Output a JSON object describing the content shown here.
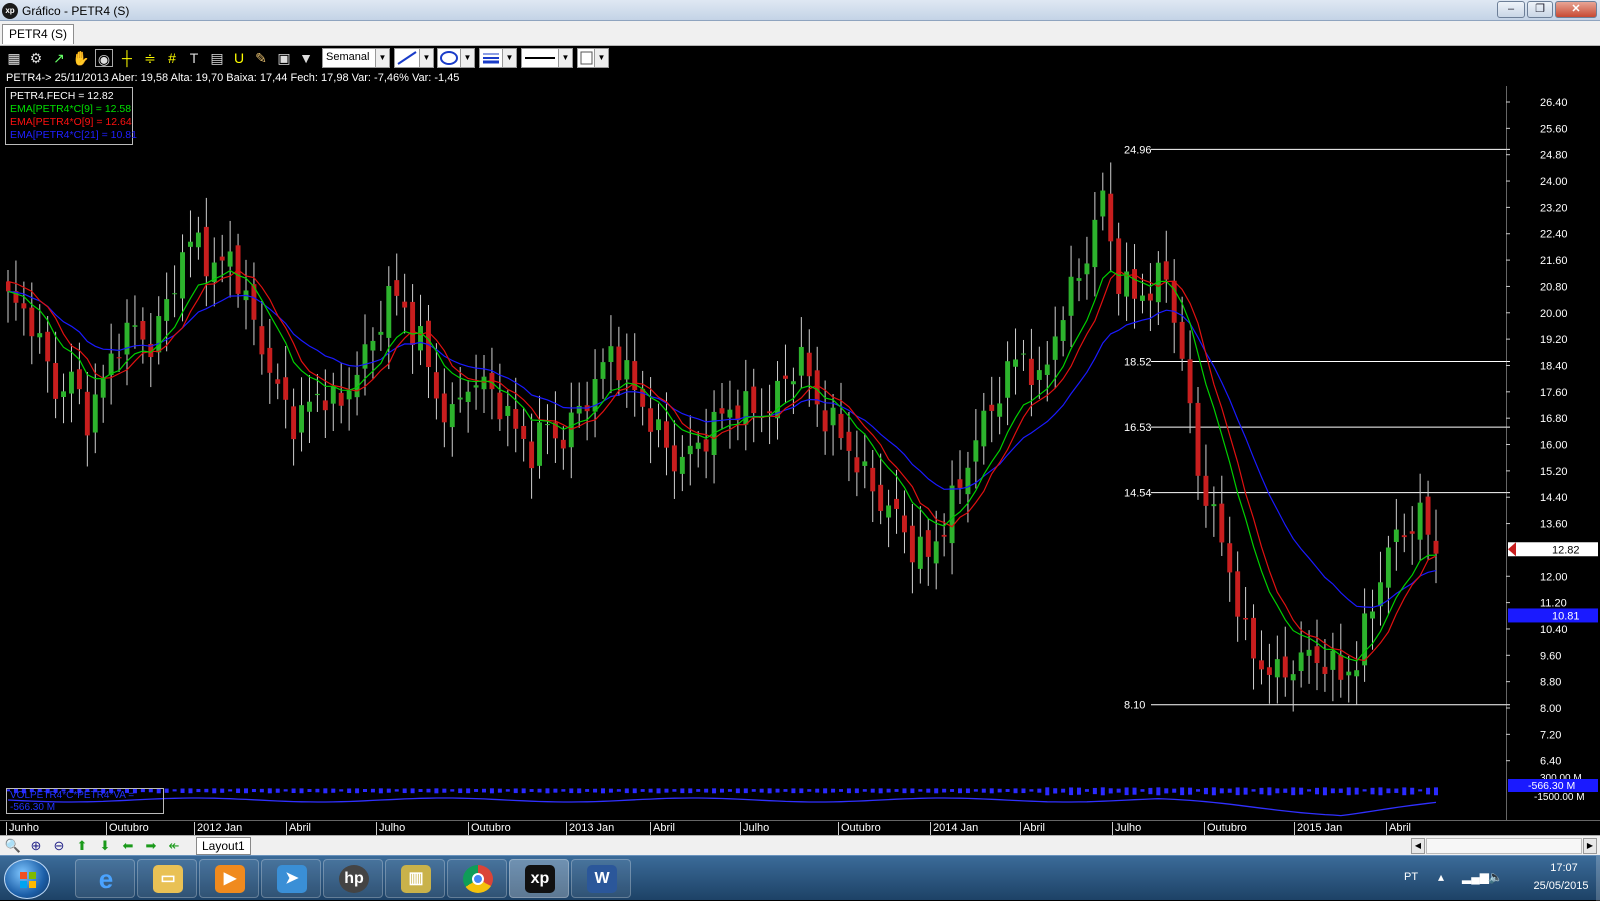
{
  "window": {
    "title": "Gráfico - PETR4 (S)",
    "app_icon": "xp",
    "min": "–",
    "max": "❐",
    "close": "✕"
  },
  "tab": {
    "label": "PETR4 (S)"
  },
  "toolbar": {
    "period": "Semanal"
  },
  "info_line": "PETR4-> 25/11/2013 Aber: 19,58 Alta: 19,70 Baixa: 17,44 Fech: 17,98 Var: -7,46% Var: -1,45",
  "legend": [
    {
      "text": "PETR4.FECH = 12.82",
      "color": "#ffffff"
    },
    {
      "text": "EMA[PETR4*C[9] = 12.58",
      "color": "#00e000"
    },
    {
      "text": "EMA[PETR4*O[9] = 12.64",
      "color": "#ff1010"
    },
    {
      "text": "EMA[PETR4*C[21] = 10.81",
      "color": "#2020ff"
    }
  ],
  "colors": {
    "up": "#2db32d",
    "down": "#c81e1e",
    "ema9c": "#00d000",
    "ema9o": "#e01010",
    "ema21": "#1a1aff",
    "grid_line": "#ffffff"
  },
  "chart_data": {
    "type": "candlestick",
    "price_axis_ticks": [
      "26.40",
      "25.60",
      "24.80",
      "24.00",
      "23.20",
      "22.40",
      "21.60",
      "20.80",
      "20.00",
      "19.20",
      "18.40",
      "17.60",
      "16.80",
      "16.00",
      "15.20",
      "14.40",
      "13.60",
      "12.00",
      "11.20",
      "10.40",
      "9.60",
      "8.80",
      "8.00",
      "7.20",
      "6.40"
    ],
    "ylim": [
      6.0,
      27.0
    ],
    "levels": [
      24.96,
      18.52,
      16.53,
      14.54,
      8.1
    ],
    "level_labels": [
      "24.96",
      "18.52",
      "16.53",
      "14.54",
      "8.10"
    ],
    "last_close": {
      "value": 12.82,
      "label": "12.82"
    },
    "ema21_last": {
      "value": 10.81,
      "label": "10.81"
    },
    "time_labels": [
      "Junho",
      "Outubro",
      "2012 Jan",
      "Abril",
      "Julho",
      "Outubro",
      "2013 Jan",
      "Abril",
      "Julho",
      "Outubro",
      "2014 Jan",
      "Abril",
      "Julho",
      "Outubro",
      "2015 Jan",
      "Abril"
    ],
    "close_path": [
      [
        0,
        20.4
      ],
      [
        3,
        19.8
      ],
      [
        6,
        17.6
      ],
      [
        8,
        18.0
      ],
      [
        10,
        16.8
      ],
      [
        12,
        17.9
      ],
      [
        14,
        19.2
      ],
      [
        16,
        19.5
      ],
      [
        18,
        19.0
      ],
      [
        20,
        20.2
      ],
      [
        22,
        21.8
      ],
      [
        24,
        22.2
      ],
      [
        26,
        21.2
      ],
      [
        28,
        21.8
      ],
      [
        30,
        20.3
      ],
      [
        32,
        19.0
      ],
      [
        34,
        17.6
      ],
      [
        36,
        16.7
      ],
      [
        38,
        17.2
      ],
      [
        40,
        17.6
      ],
      [
        42,
        17.1
      ],
      [
        44,
        18.4
      ],
      [
        46,
        19.0
      ],
      [
        48,
        20.7
      ],
      [
        50,
        20.0
      ],
      [
        52,
        19.2
      ],
      [
        54,
        17.4
      ],
      [
        56,
        16.8
      ],
      [
        58,
        17.9
      ],
      [
        60,
        17.8
      ],
      [
        62,
        17.3
      ],
      [
        64,
        16.4
      ],
      [
        66,
        15.8
      ],
      [
        68,
        16.6
      ],
      [
        70,
        16.1
      ],
      [
        72,
        17.1
      ],
      [
        74,
        17.8
      ],
      [
        76,
        18.9
      ],
      [
        78,
        18.1
      ],
      [
        80,
        17.2
      ],
      [
        82,
        16.3
      ],
      [
        84,
        15.5
      ],
      [
        86,
        15.7
      ],
      [
        88,
        16.3
      ],
      [
        90,
        16.9
      ],
      [
        92,
        17.2
      ],
      [
        94,
        17.0
      ],
      [
        96,
        17.1
      ],
      [
        98,
        18.0
      ],
      [
        100,
        18.7
      ],
      [
        102,
        17.2
      ],
      [
        104,
        16.6
      ],
      [
        106,
        15.9
      ],
      [
        108,
        15.0
      ],
      [
        110,
        14.3
      ],
      [
        112,
        13.8
      ],
      [
        114,
        12.9
      ],
      [
        116,
        12.6
      ],
      [
        118,
        13.6
      ],
      [
        120,
        14.8
      ],
      [
        122,
        16.2
      ],
      [
        124,
        17.1
      ],
      [
        126,
        18.2
      ],
      [
        128,
        18.8
      ],
      [
        130,
        17.7
      ],
      [
        132,
        19.4
      ],
      [
        134,
        20.6
      ],
      [
        136,
        21.8
      ],
      [
        138,
        23.5
      ],
      [
        140,
        21.0
      ],
      [
        142,
        20.5
      ],
      [
        144,
        20.7
      ],
      [
        146,
        21.2
      ],
      [
        148,
        18.6
      ],
      [
        150,
        15.2
      ],
      [
        152,
        13.8
      ],
      [
        154,
        12.2
      ],
      [
        156,
        10.1
      ],
      [
        158,
        9.3
      ],
      [
        160,
        9.0
      ],
      [
        162,
        9.3
      ],
      [
        164,
        9.6
      ],
      [
        166,
        9.4
      ],
      [
        168,
        9.0
      ],
      [
        170,
        9.4
      ],
      [
        172,
        11.2
      ],
      [
        174,
        12.8
      ],
      [
        176,
        13.4
      ],
      [
        178,
        13.8
      ],
      [
        180,
        12.8
      ]
    ]
  },
  "volume_label": "VOLPETR4*C*PETR4*VA = -566.30 M",
  "volume_value": "-566.30 M",
  "volume_ticks": [
    "300.00 M",
    "-1500.00 M"
  ],
  "nav": {
    "layout_tab": "Layout1"
  },
  "taskbar": {
    "apps": [
      "ie",
      "explorer",
      "media-player",
      "app-4",
      "hp",
      "app-6",
      "chrome",
      "xp",
      "word"
    ],
    "lang": "PT",
    "time": "17:07",
    "date": "25/05/2015"
  }
}
